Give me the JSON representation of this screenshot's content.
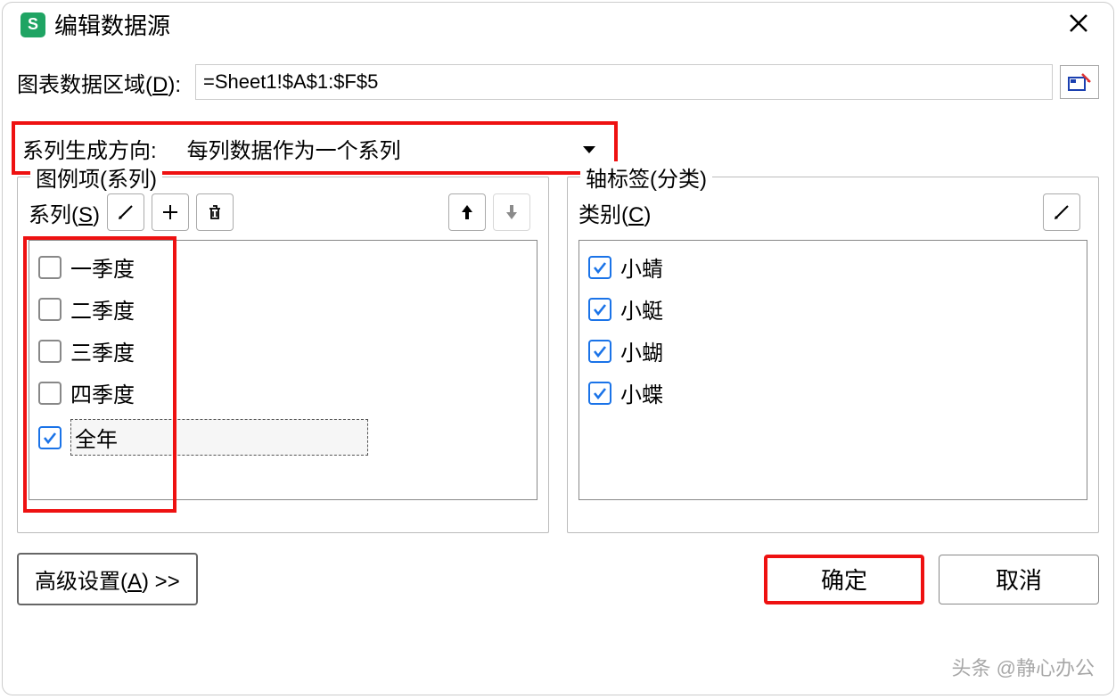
{
  "dialog": {
    "app_icon_text": "S",
    "title": "编辑数据源"
  },
  "range": {
    "label_prefix": "图表数据区域(",
    "label_key": "D",
    "label_suffix": "):",
    "value": "=Sheet1!$A$1:$F$5"
  },
  "direction": {
    "label": "系列生成方向:",
    "value": "每列数据作为一个系列"
  },
  "series_panel": {
    "legend": "图例项(系列)",
    "label_prefix": "系列(",
    "label_key": "S",
    "label_suffix": ")",
    "items": [
      {
        "label": "一季度",
        "checked": false,
        "selected": false
      },
      {
        "label": "二季度",
        "checked": false,
        "selected": false
      },
      {
        "label": "三季度",
        "checked": false,
        "selected": false
      },
      {
        "label": "四季度",
        "checked": false,
        "selected": false
      },
      {
        "label": "全年",
        "checked": true,
        "selected": true
      }
    ]
  },
  "category_panel": {
    "legend": "轴标签(分类)",
    "label_prefix": "类别(",
    "label_key": "C",
    "label_suffix": ")",
    "items": [
      {
        "label": "小蜻",
        "checked": true
      },
      {
        "label": "小蜓",
        "checked": true
      },
      {
        "label": "小蝴",
        "checked": true
      },
      {
        "label": "小蝶",
        "checked": true
      }
    ]
  },
  "footer": {
    "advanced_prefix": "高级设置(",
    "advanced_key": "A",
    "advanced_suffix": ") >>",
    "ok": "确定",
    "cancel": "取消"
  },
  "watermark": "头条 @静心办公"
}
